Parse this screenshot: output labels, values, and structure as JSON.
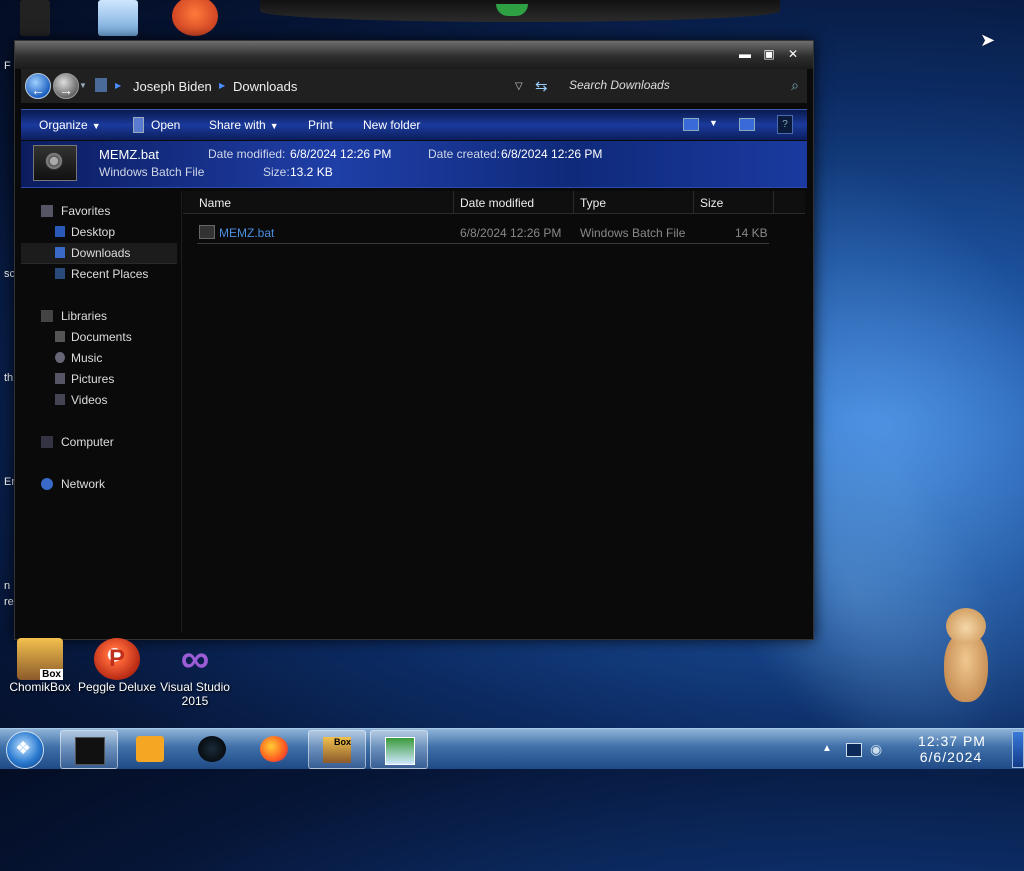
{
  "desktop": {
    "edge_texts": [
      "F",
      "sc",
      "th",
      "Er",
      "n",
      "re"
    ],
    "icons": [
      {
        "label": "ChomikBox",
        "badge": "Box"
      },
      {
        "label": "Peggle Deluxe"
      },
      {
        "label": "Visual Studio 2015"
      }
    ]
  },
  "window": {
    "controls": {
      "minimize": "▬",
      "maximize": "▣",
      "close": "✕"
    },
    "address": {
      "breadcrumb": [
        "Joseph Biden",
        "Downloads"
      ],
      "search_placeholder": "Search Downloads"
    },
    "toolbar": {
      "organize": "Organize",
      "open": "Open",
      "share_with": "Share with",
      "print": "Print",
      "new_folder": "New folder"
    },
    "details": {
      "file_name": "MEMZ.bat",
      "file_type": "Windows Batch File",
      "date_modified_label": "Date modified:",
      "date_modified": "6/8/2024 12:26 PM",
      "date_created_label": "Date created:",
      "date_created": "6/8/2024 12:26 PM",
      "size_label": "Size:",
      "size": "13.2 KB"
    },
    "nav": {
      "favorites": "Favorites",
      "desktop": "Desktop",
      "downloads": "Downloads",
      "recent_places": "Recent Places",
      "libraries": "Libraries",
      "documents": "Documents",
      "music": "Music",
      "pictures": "Pictures",
      "videos": "Videos",
      "computer": "Computer",
      "network": "Network"
    },
    "columns": {
      "name": "Name",
      "date_modified": "Date modified",
      "type": "Type",
      "size": "Size"
    },
    "files": [
      {
        "name": "MEMZ.bat",
        "date_modified": "6/8/2024 12:26 PM",
        "type": "Windows Batch File",
        "size": "14 KB"
      }
    ]
  },
  "taskbar": {
    "time": "12:37 PM",
    "date": "6/6/2024",
    "chomik_badge": "Box"
  }
}
